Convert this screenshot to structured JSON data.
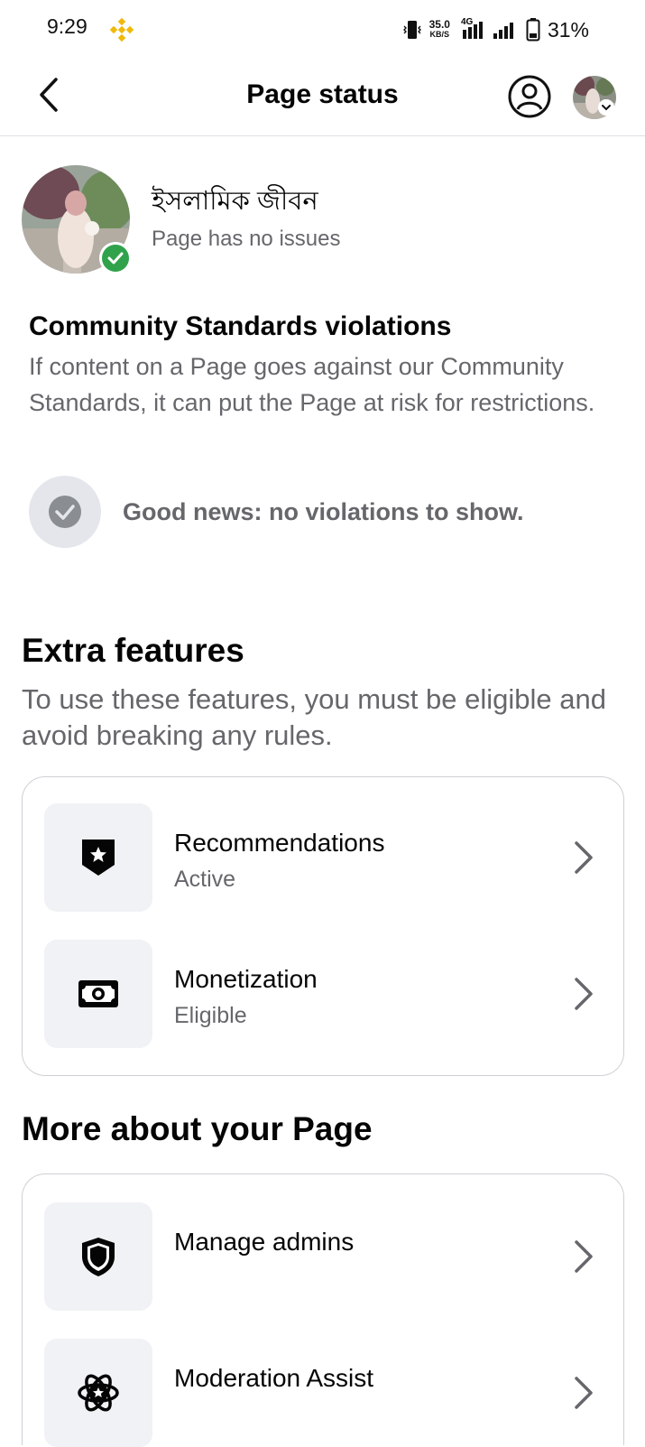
{
  "status_bar": {
    "time": "9:29",
    "speed_value": "35.0",
    "speed_unit": "KB/S",
    "network": "4G",
    "battery": "31%"
  },
  "header": {
    "title": "Page status",
    "back_icon": "chevron-left-icon",
    "profile_icon": "person-circle-icon"
  },
  "page": {
    "name": "ইসলামিক জীবন",
    "status": "Page has no issues"
  },
  "community_standards": {
    "title": "Community Standards violations",
    "description": "If content on a Page goes against our Community Standards, it can put the Page at risk for restrictions.",
    "good_news": "Good news: no violations to show."
  },
  "extra_features": {
    "title": "Extra features",
    "description": "To use these features, you must be eligible and avoid breaking any rules.",
    "items": [
      {
        "label": "Recommendations",
        "status": "Active",
        "icon": "star-badge-icon"
      },
      {
        "label": "Monetization",
        "status": "Eligible",
        "icon": "money-icon"
      }
    ]
  },
  "more_about": {
    "title": "More about your Page",
    "items": [
      {
        "label": "Manage admins",
        "icon": "shield-icon"
      },
      {
        "label": "Moderation Assist",
        "icon": "atom-star-icon"
      }
    ]
  },
  "colors": {
    "text_primary": "#050505",
    "text_secondary": "#65676b",
    "verified_green": "#31a24c",
    "icon_bg": "#f0f2f5",
    "binance_yellow": "#f0b90b"
  }
}
